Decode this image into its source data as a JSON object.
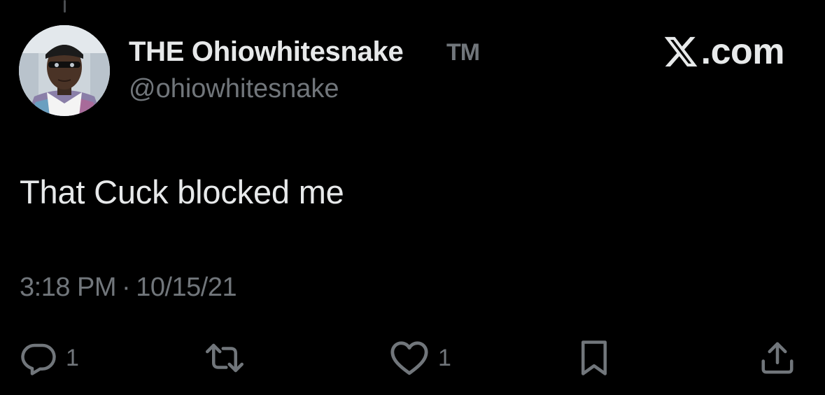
{
  "author": {
    "display_name": "THE Ohiowhitesnake",
    "trademark": "TM",
    "handle": "@ohiowhitesnake"
  },
  "brand": {
    "label": ".com",
    "icon": "x-logo-icon"
  },
  "tweet": {
    "text": "That Cuck blocked me",
    "time": "3:18 PM",
    "separator": "·",
    "date": "10/15/21"
  },
  "actions": {
    "reply": {
      "icon": "reply-icon",
      "count": "1"
    },
    "retweet": {
      "icon": "retweet-icon",
      "count": ""
    },
    "like": {
      "icon": "heart-icon",
      "count": "1"
    },
    "bookmark": {
      "icon": "bookmark-icon"
    },
    "share": {
      "icon": "share-icon"
    }
  },
  "colors": {
    "background": "#000000",
    "primary_text": "#e7e9ea",
    "secondary_text": "#71767b"
  }
}
